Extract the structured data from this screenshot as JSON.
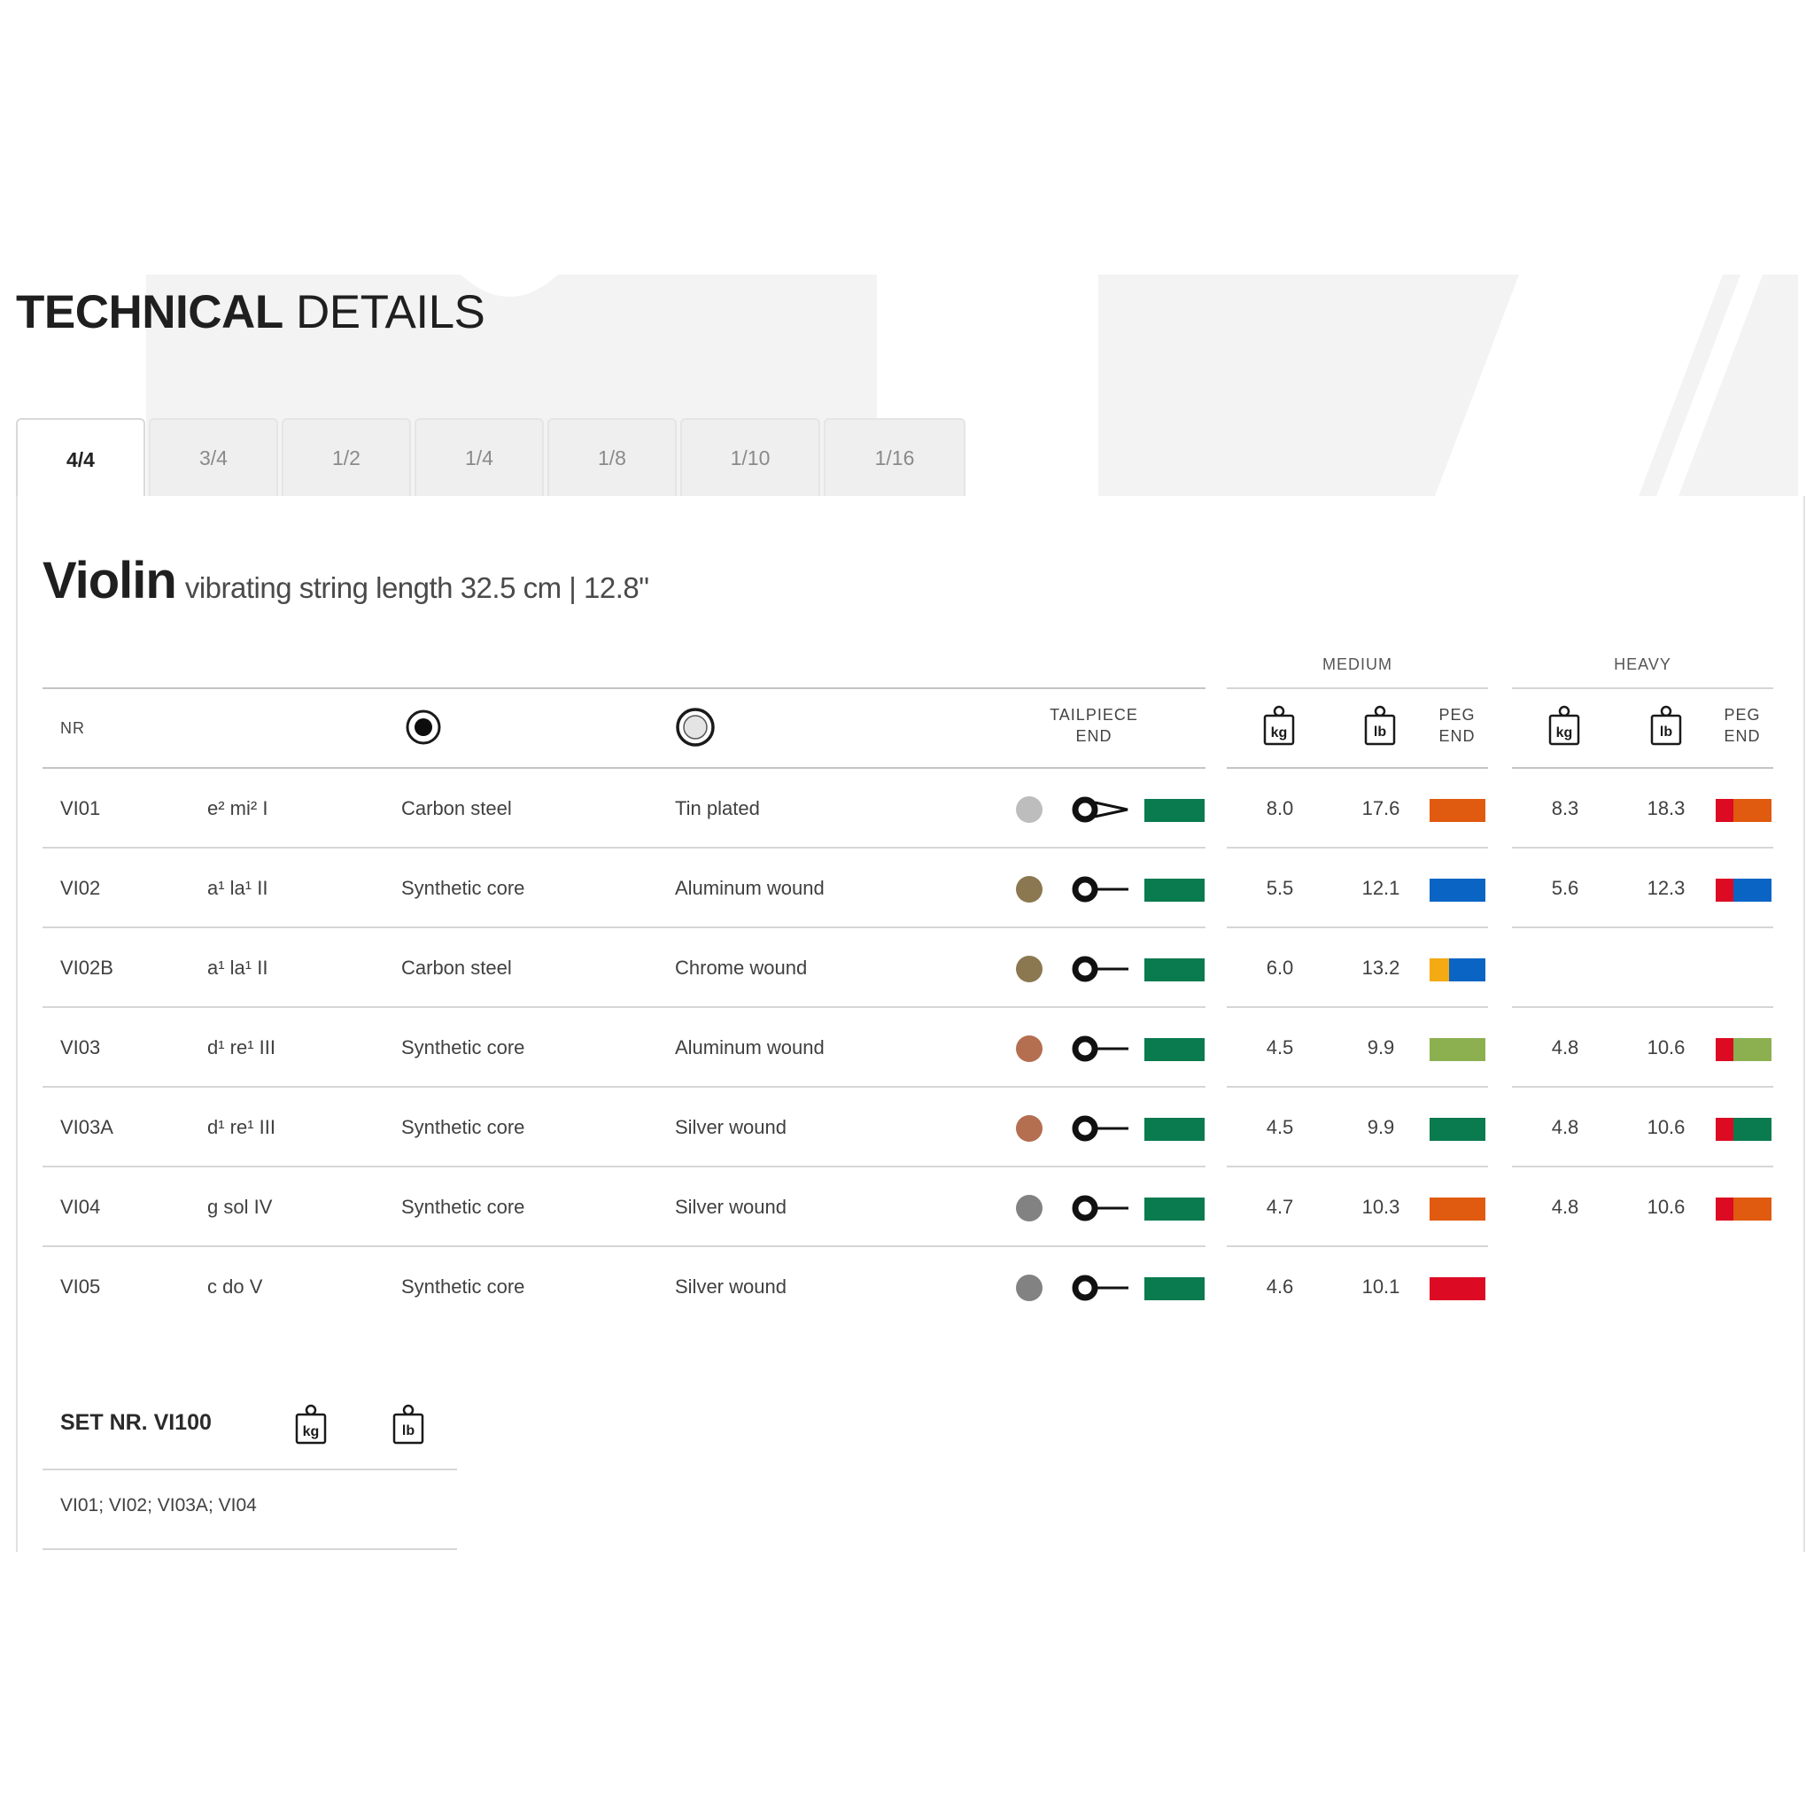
{
  "page": {
    "title_bold": "TECHNICAL",
    "title_light": "DETAILS"
  },
  "tabs": [
    {
      "label": "4/4",
      "active": true
    },
    {
      "label": "3/4",
      "active": false
    },
    {
      "label": "1/2",
      "active": false
    },
    {
      "label": "1/4",
      "active": false
    },
    {
      "label": "1/8",
      "active": false
    },
    {
      "label": "1/10",
      "active": false
    },
    {
      "label": "1/16",
      "active": false
    }
  ],
  "instrument": {
    "name": "Violin",
    "subtitle": "vibrating string length 32.5 cm | 12.8\""
  },
  "groups": {
    "medium": "MEDIUM",
    "heavy": "HEAVY"
  },
  "headers": {
    "nr": "NR",
    "core_icon": "solid-core-icon",
    "winding_icon": "winding-icon",
    "tailpiece_end_line1": "TAILPIECE",
    "tailpiece_end_line2": "END",
    "kg_icon": "kg-weight-icon",
    "lb_icon": "lb-weight-icon",
    "peg_end_line1": "PEG",
    "peg_end_line2": "END"
  },
  "colors": {
    "green": "#0a7a4f",
    "orange": "#e05a10",
    "blue": "#0a64c4",
    "red": "#dc0a23",
    "yellow": "#f4aa12",
    "lightgreen": "#8cb050",
    "silver": "#bdbdbd",
    "bronze": "#8b7850",
    "copper": "#b46e50",
    "grey": "#828282"
  },
  "rows": [
    {
      "nr": "VI01",
      "note": "e² mi² I",
      "core": "Carbon steel",
      "winding": "Tin plated",
      "winding_color": "silver",
      "ball_end": false,
      "tail_color": [
        "green"
      ],
      "medium_kg": "8.0",
      "medium_lb": "17.6",
      "medium_peg": [
        "orange"
      ],
      "heavy_kg": "8.3",
      "heavy_lb": "18.3",
      "heavy_peg": [
        "red",
        "orange"
      ]
    },
    {
      "nr": "VI02",
      "note": "a¹ la¹ II",
      "core": "Synthetic core",
      "winding": "Aluminum wound",
      "winding_color": "bronze",
      "ball_end": true,
      "tail_color": [
        "green"
      ],
      "medium_kg": "5.5",
      "medium_lb": "12.1",
      "medium_peg": [
        "blue"
      ],
      "heavy_kg": "5.6",
      "heavy_lb": "12.3",
      "heavy_peg": [
        "red",
        "blue"
      ]
    },
    {
      "nr": "VI02B",
      "note": "a¹ la¹ II",
      "core": "Carbon steel",
      "winding": "Chrome wound",
      "winding_color": "bronze",
      "ball_end": true,
      "tail_color": [
        "green"
      ],
      "medium_kg": "6.0",
      "medium_lb": "13.2",
      "medium_peg": [
        "yellow",
        "blue"
      ],
      "heavy_kg": "",
      "heavy_lb": "",
      "heavy_peg": []
    },
    {
      "nr": "VI03",
      "note": "d¹ re¹ III",
      "core": "Synthetic core",
      "winding": "Aluminum wound",
      "winding_color": "copper",
      "ball_end": true,
      "tail_color": [
        "green"
      ],
      "medium_kg": "4.5",
      "medium_lb": "9.9",
      "medium_peg": [
        "lightgreen"
      ],
      "heavy_kg": "4.8",
      "heavy_lb": "10.6",
      "heavy_peg": [
        "red",
        "lightgreen"
      ]
    },
    {
      "nr": "VI03A",
      "note": "d¹ re¹ III",
      "core": "Synthetic core",
      "winding": "Silver wound",
      "winding_color": "copper",
      "ball_end": true,
      "tail_color": [
        "green"
      ],
      "medium_kg": "4.5",
      "medium_lb": "9.9",
      "medium_peg": [
        "green"
      ],
      "heavy_kg": "4.8",
      "heavy_lb": "10.6",
      "heavy_peg": [
        "red",
        "green"
      ]
    },
    {
      "nr": "VI04",
      "note": "g sol IV",
      "core": "Synthetic core",
      "winding": "Silver wound",
      "winding_color": "grey",
      "ball_end": true,
      "tail_color": [
        "green"
      ],
      "medium_kg": "4.7",
      "medium_lb": "10.3",
      "medium_peg": [
        "orange"
      ],
      "heavy_kg": "4.8",
      "heavy_lb": "10.6",
      "heavy_peg": [
        "red",
        "orange"
      ]
    },
    {
      "nr": "VI05",
      "note": "c do V",
      "core": "Synthetic core",
      "winding": "Silver wound",
      "winding_color": "grey",
      "ball_end": true,
      "tail_color": [
        "green"
      ],
      "medium_kg": "4.6",
      "medium_lb": "10.1",
      "medium_peg": [
        "red"
      ],
      "heavy_kg": "",
      "heavy_lb": "",
      "heavy_peg": []
    }
  ],
  "set": {
    "title": "SET NR. VI100",
    "kg_icon": "kg-weight-icon",
    "lb_icon": "lb-weight-icon",
    "contents": "VI01; VI02; VI03A; VI04"
  }
}
